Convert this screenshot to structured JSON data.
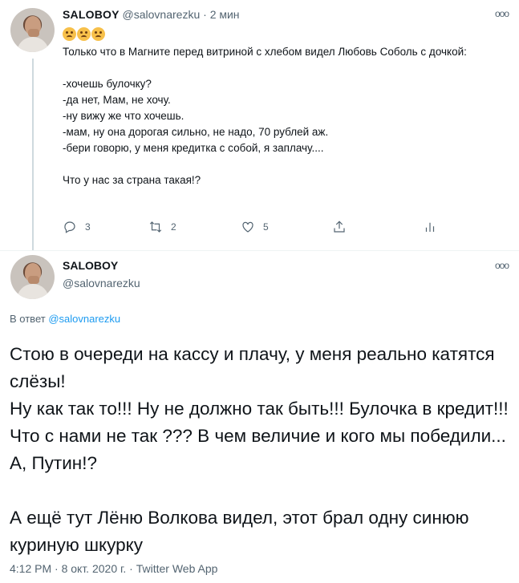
{
  "tweet1": {
    "name": "SALOBOY",
    "handle": "@salovnarezku",
    "separator": "·",
    "time": "2 мин",
    "emojis": [
      "confounded-face",
      "confounded-face",
      "confounded-face"
    ],
    "text": "Только что в Магните перед витриной с хлебом видел Любовь Соболь с дочкой:\n\n-хочешь булочку?\n-да нет, Мам, не хочу.\n-ну вижу же что хочешь.\n-мам, ну она дорогая сильно, не надо, 70 рублей аж.\n-бери говорю, у меня кредитка с собой, я заплачу....\n\nЧто у нас за страна такая!?",
    "actions": {
      "reply_count": "3",
      "retweet_count": "2",
      "like_count": "5",
      "share_icon": "share-icon",
      "analytics_icon": "analytics-icon"
    },
    "more_label": "ooo"
  },
  "tweet2": {
    "name": "SALOBOY",
    "handle": "@salovnarezku",
    "more_label": "ooo",
    "reply_prefix": "В ответ",
    "reply_handle": "@salovnarezku",
    "text": "Стою в очереди на кассу и плачу, у меня реально катятся слёзы!\nНу как так то!!! Ну не должно так быть!!! Булочка в кредит!!! Что с нами не так ??? В чем величие и кого мы победили... А, Путин!?\n\nА ещё тут Лёню Волкова видел, этот брал одну синюю куриную шкурку",
    "meta": "4:12 PM · 8 окт. 2020 г. · Twitter Web App"
  },
  "colors": {
    "text": "#0f1419",
    "secondary": "#536471",
    "link": "#1d9bf0",
    "thread_line": "#cfd9de"
  }
}
